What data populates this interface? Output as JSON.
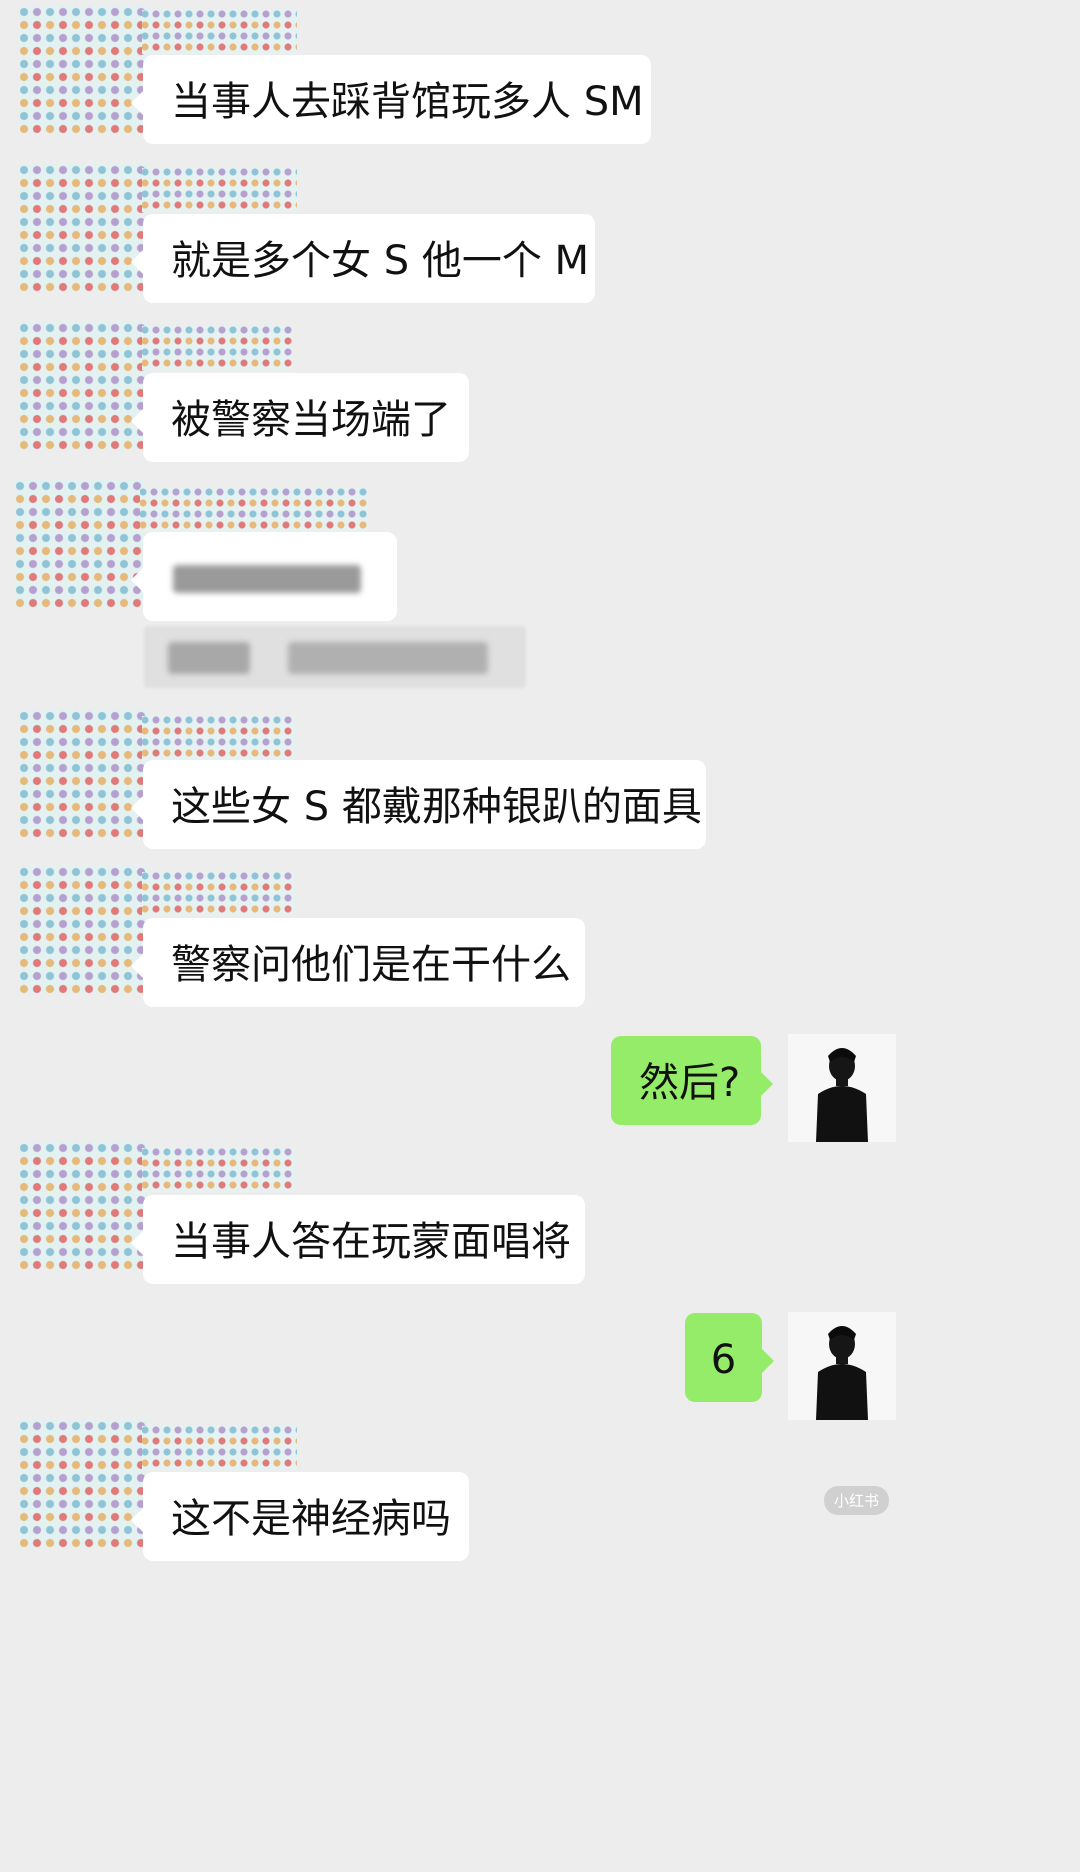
{
  "messages": [
    {
      "text": "当事人去踩背馆玩多人 SM"
    },
    {
      "text": "就是多个女 S 他一个 M"
    },
    {
      "text": "被警察当场端了"
    },
    {
      "text": "这些女 S 都戴那种银趴的面具"
    },
    {
      "text": "警察问他们是在干什么"
    },
    {
      "text": "然后?"
    },
    {
      "text": "当事人答在玩蒙面唱将"
    },
    {
      "text": "6"
    },
    {
      "text": "这不是神经病吗"
    }
  ],
  "watermark": "小红书",
  "colors": {
    "background": "#ededed",
    "incoming_bubble": "#ffffff",
    "outgoing_bubble": "#95ec69"
  }
}
